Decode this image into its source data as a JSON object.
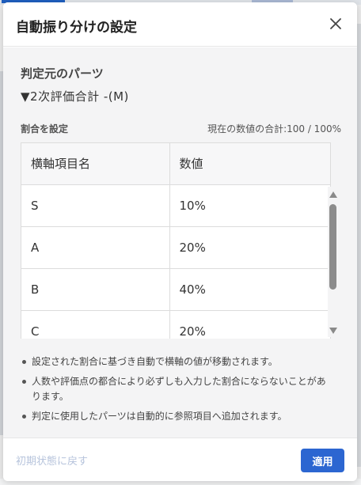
{
  "dialog": {
    "title": "自動振り分けの設定",
    "section_title": "判定元のパーツ",
    "parts_name": "▼2次評価合計 -(M)",
    "ratio_label": "割合を設定",
    "total_label": "現在の数値の合計:100 / 100%",
    "table": {
      "headers": [
        "横軸項目名",
        "数値"
      ],
      "rows": [
        {
          "name": "S",
          "value": "10%"
        },
        {
          "name": "A",
          "value": "20%"
        },
        {
          "name": "B",
          "value": "40%"
        },
        {
          "name": "C",
          "value": "20%"
        }
      ]
    },
    "notes": [
      "設定された割合に基づき自動で横軸の値が移動されます。",
      "人数や評価点の都合により必ずしも入力した割合にならないことがあります。",
      "判定に使用したパーツは自動的に参照項目へ追加されます。"
    ],
    "footer": {
      "reset_label": "初期状態に戻す",
      "apply_label": "適用"
    }
  },
  "colors": {
    "primary": "#2c66d1",
    "disabled_link": "#b7c4dc"
  },
  "icons": {
    "close": "close-icon"
  }
}
